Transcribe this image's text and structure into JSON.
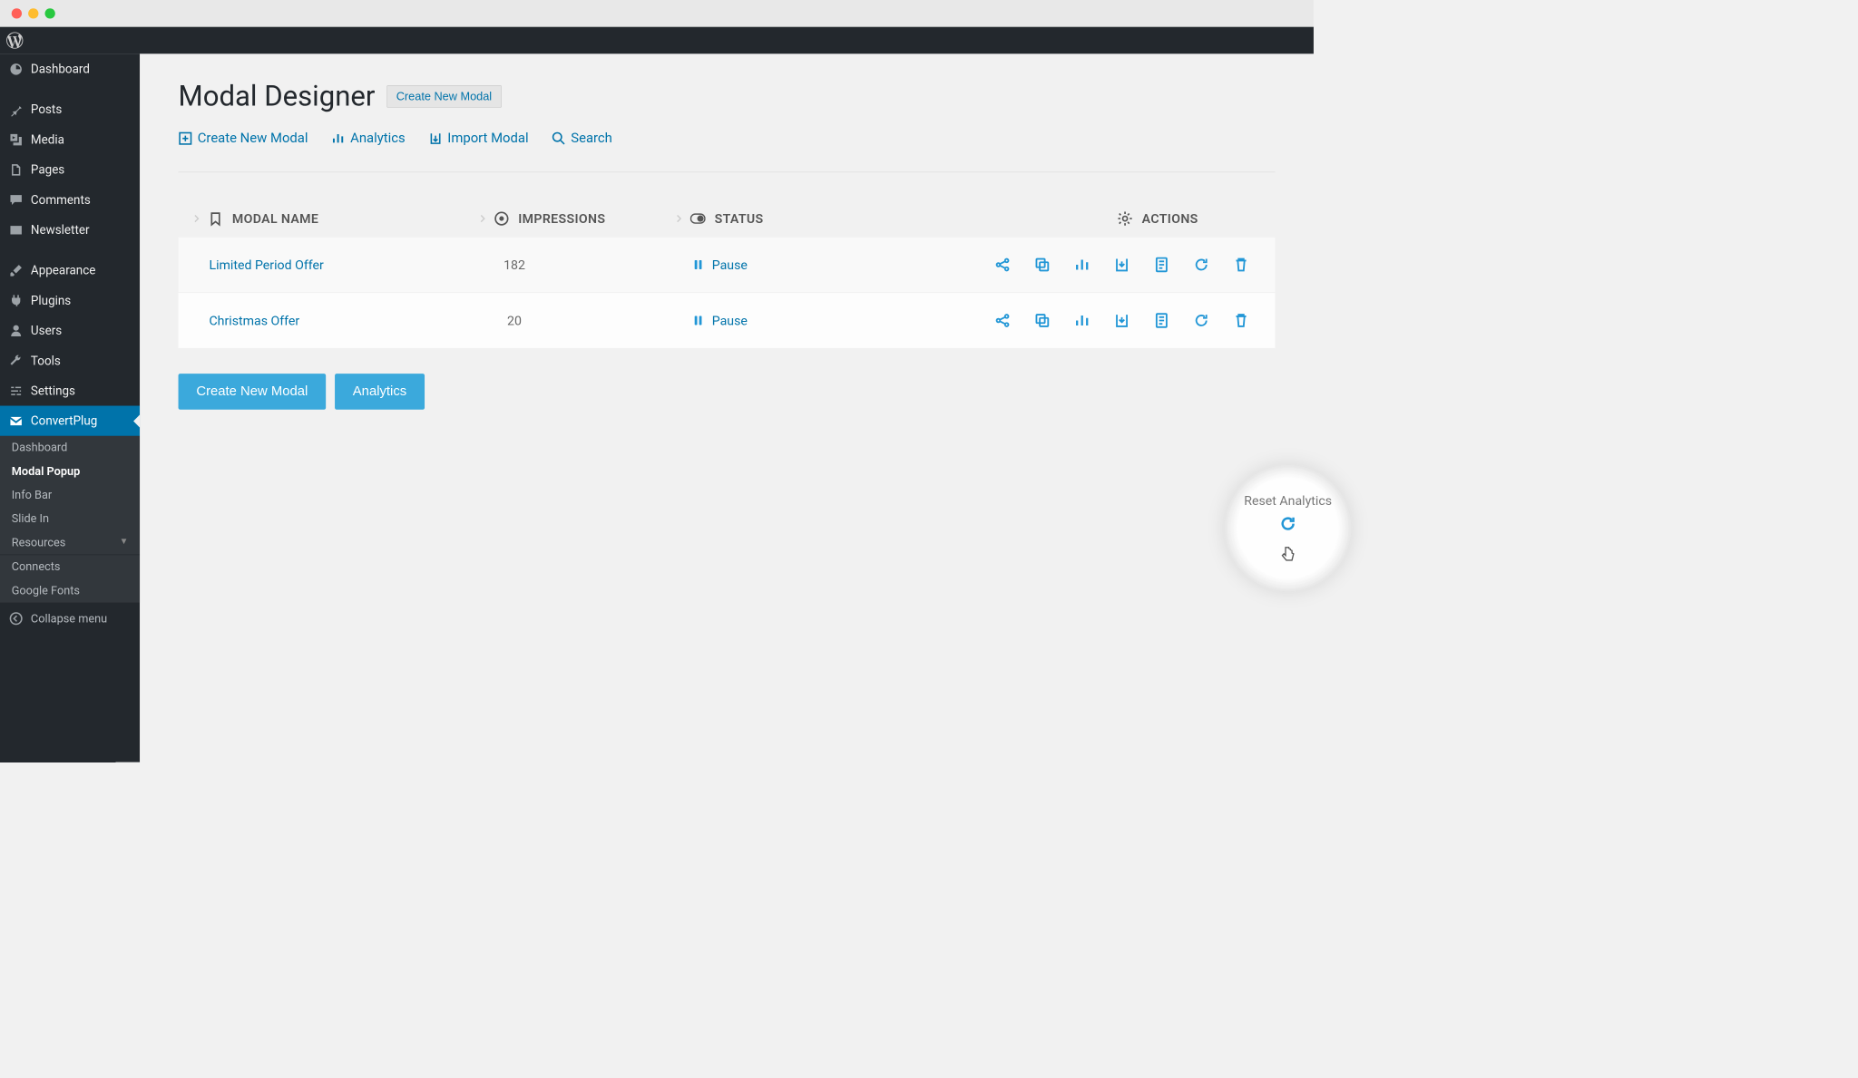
{
  "sidebar": {
    "items": [
      {
        "label": "Dashboard"
      },
      {
        "label": "Posts"
      },
      {
        "label": "Media"
      },
      {
        "label": "Pages"
      },
      {
        "label": "Comments"
      },
      {
        "label": "Newsletter"
      },
      {
        "label": "Appearance"
      },
      {
        "label": "Plugins"
      },
      {
        "label": "Users"
      },
      {
        "label": "Tools"
      },
      {
        "label": "Settings"
      },
      {
        "label": "ConvertPlug"
      }
    ],
    "submenu": [
      {
        "label": "Dashboard"
      },
      {
        "label": "Modal Popup"
      },
      {
        "label": "Info Bar"
      },
      {
        "label": "Slide In"
      },
      {
        "label": "Resources"
      }
    ],
    "extra": [
      {
        "label": "Connects"
      },
      {
        "label": "Google Fonts"
      }
    ],
    "collapse": "Collapse menu"
  },
  "page": {
    "title": "Modal Designer",
    "create_btn": "Create New Modal"
  },
  "toolbar": {
    "create": "Create New Modal",
    "analytics": "Analytics",
    "import": "Import Modal",
    "search": "Search"
  },
  "table": {
    "headers": {
      "name": "MODAL NAME",
      "impressions": "IMPRESSIONS",
      "status": "STATUS",
      "actions": "ACTIONS"
    },
    "rows": [
      {
        "name": "Limited Period Offer",
        "impressions": "182",
        "status": "Pause"
      },
      {
        "name": "Christmas Offer",
        "impressions": "20",
        "status": "Pause"
      }
    ]
  },
  "footer": {
    "create": "Create New Modal",
    "analytics": "Analytics"
  },
  "tooltip": {
    "reset": "Reset Analytics"
  }
}
